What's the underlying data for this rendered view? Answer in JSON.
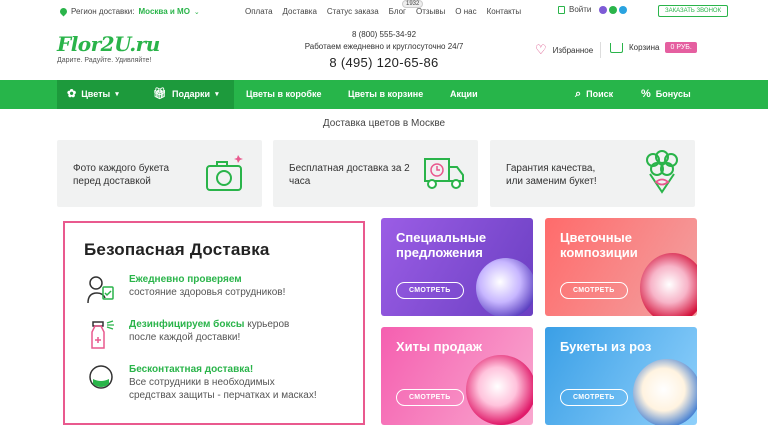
{
  "topbar": {
    "region_label": "Регион доставки:",
    "region_value": "Москва и МО",
    "links": [
      "Оплата",
      "Доставка",
      "Статус заказа",
      "Блог",
      "Отзывы",
      "О нас",
      "Контакты"
    ],
    "reviews_count": "1932",
    "login": "Войти",
    "callback": "ЗАКАЗАТЬ ЗВОНОК"
  },
  "header": {
    "logo_name": "Flor2U.ru",
    "logo_tagline": "Дарите. Радуйте. Удивляйте!",
    "phone1": "8 (800) 555-34-92",
    "hours": "Работаем ежедневно и круглосуточно 24/7",
    "phone2": "8 (495) 120-65-86",
    "favorites": "Избранное",
    "cart": "Корзина",
    "cart_amount": "0 РУБ."
  },
  "nav": {
    "items": [
      "Цветы",
      "Подарки",
      "Цветы в коробке",
      "Цветы в корзине",
      "Акции",
      "Поиск",
      "Бонусы"
    ]
  },
  "subtitle": "Доставка цветов в Москве",
  "features": [
    {
      "line1": "Фото каждого букета",
      "line2": "перед доставкой"
    },
    {
      "line1": "Бесплатная доставка за 2",
      "line2": "часа"
    },
    {
      "line1": "Гарантия качества,",
      "line2": "или заменим букет!"
    }
  ],
  "safe_delivery": {
    "title": "Безопасная Доставка",
    "rows": [
      {
        "bold": "Ежедневно проверяем",
        "rest": "состояние здоровья сотрудников!",
        "extra": ""
      },
      {
        "bold": "Дезинфицируем боксы",
        "rest": " курьеров",
        "extra": "после каждой доставки!"
      },
      {
        "bold": "Бесконтактная доставка!",
        "rest": "Все сотрудники в необходимых",
        "extra": "средствах защиты - перчатках и масках!"
      }
    ]
  },
  "promos": [
    {
      "title1": "Специальные",
      "title2": "предложения",
      "button": "СМОТРЕТЬ",
      "color": "#8a56d0"
    },
    {
      "title1": "Цветочные",
      "title2": "композиции",
      "button": "СМОТРЕТЬ",
      "color": "#ef5b5b"
    },
    {
      "title1": "Хиты продаж",
      "title2": "",
      "button": "СМОТРЕТЬ",
      "color": "#ef5fae"
    },
    {
      "title1": "Букеты из роз",
      "title2": "",
      "button": "СМОТРЕТЬ",
      "color": "#3a9fe6"
    }
  ],
  "colors": {
    "brand_green": "#27b54a",
    "accent_pink": "#e9598e"
  }
}
